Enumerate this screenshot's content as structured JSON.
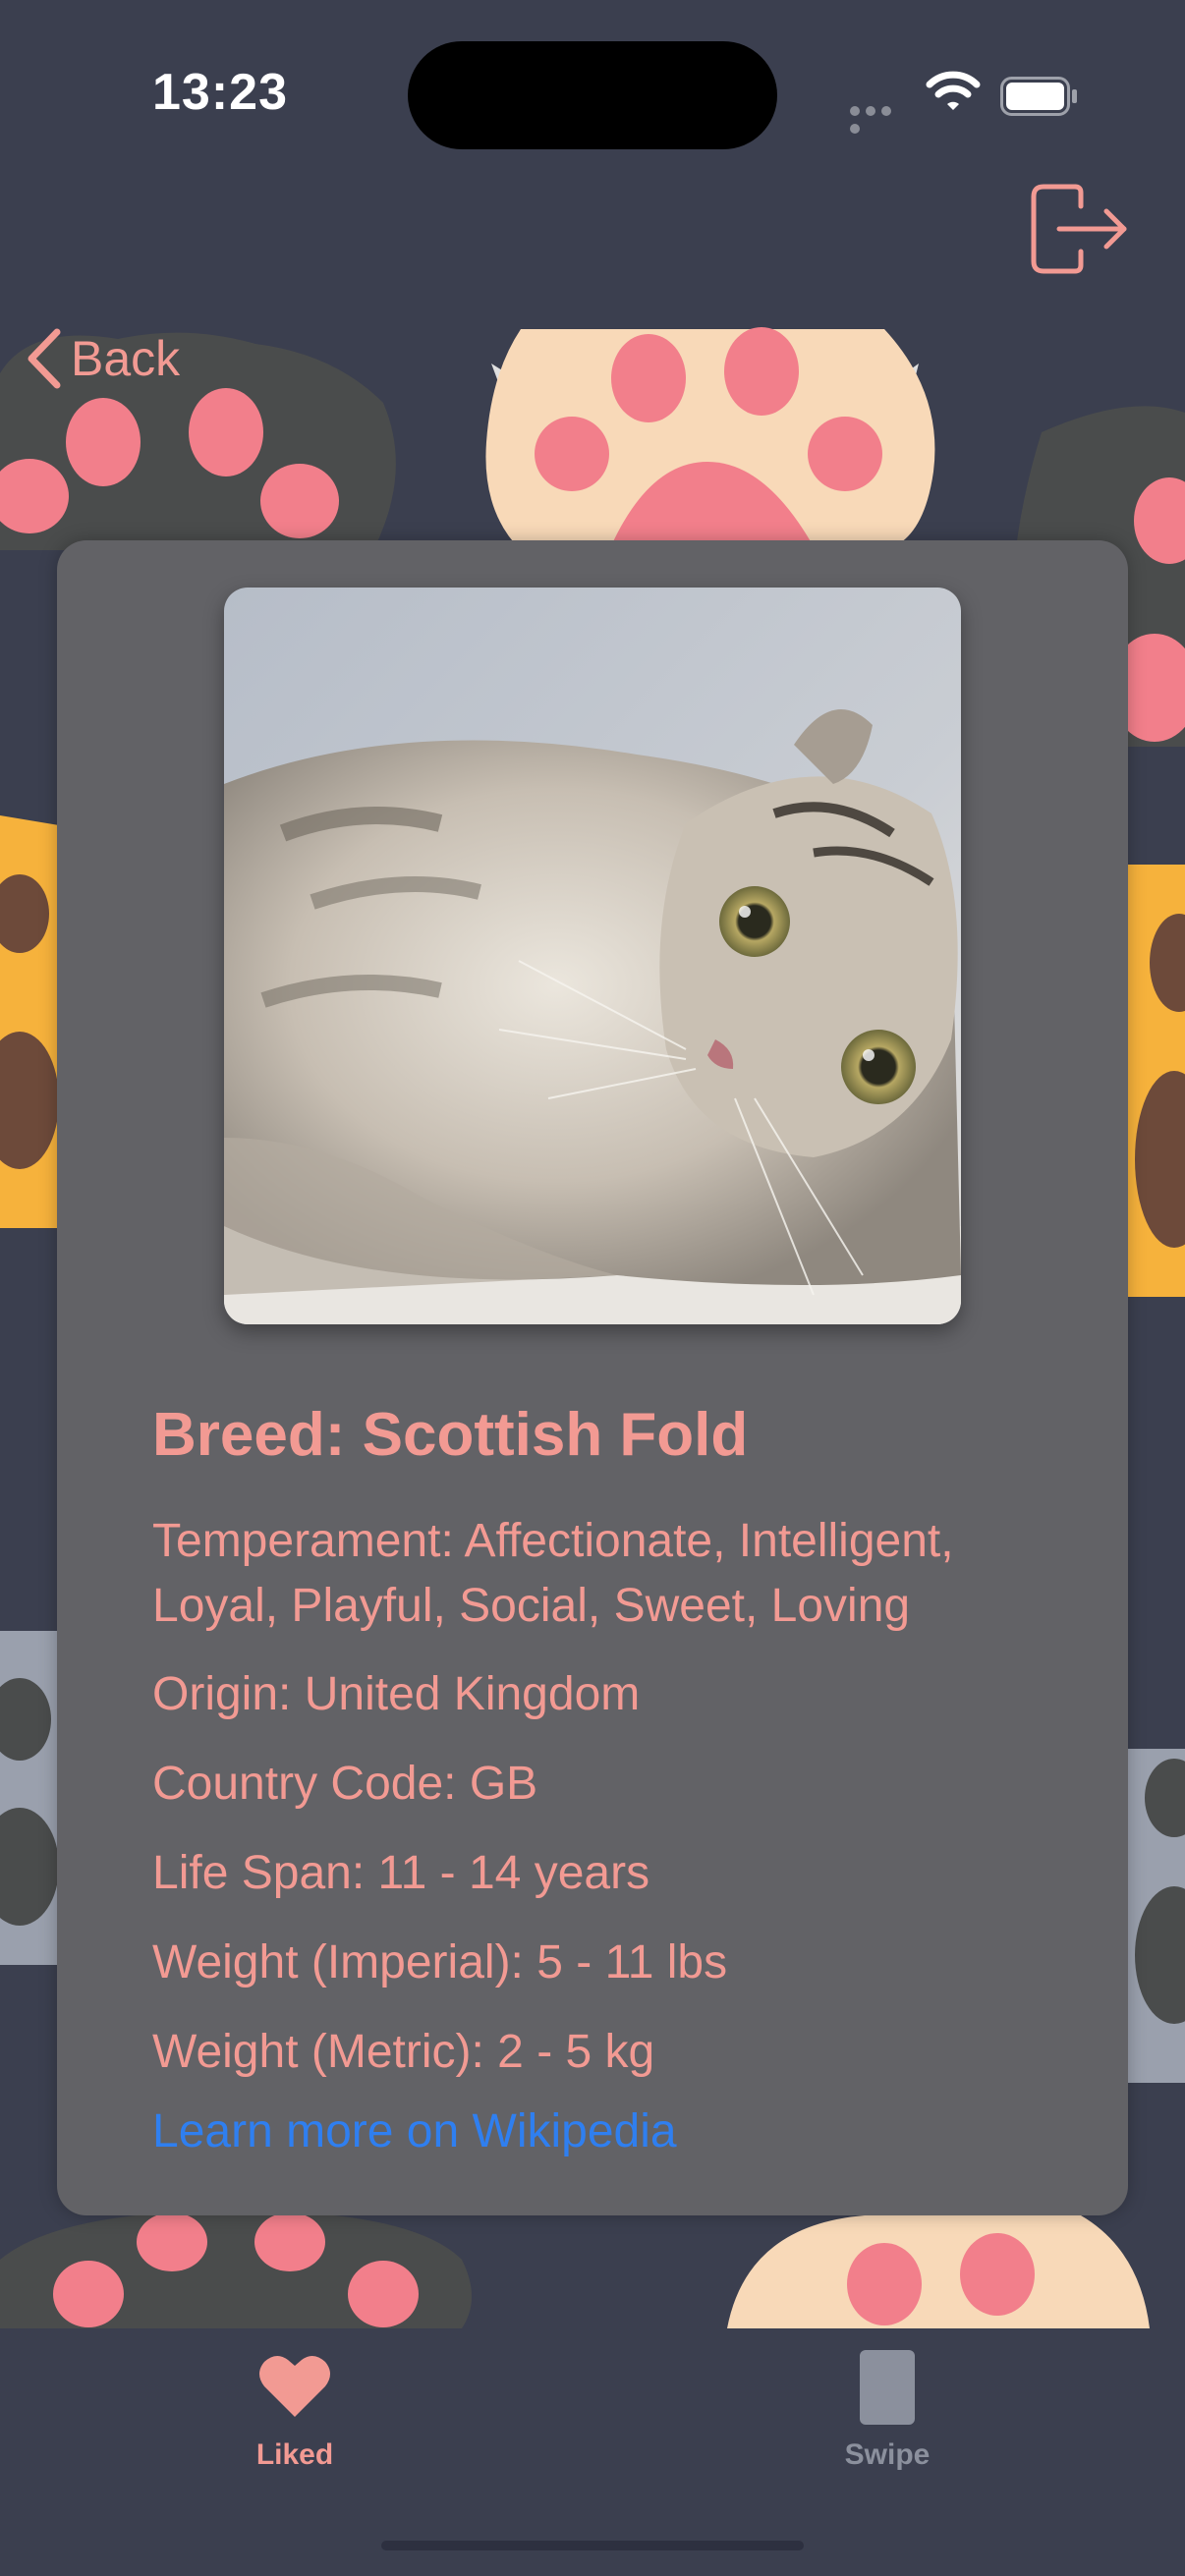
{
  "status_bar": {
    "time": "13:23"
  },
  "header": {
    "back_label": "Back",
    "logout_icon": "logout-icon"
  },
  "detail": {
    "breed": "Breed: Scottish Fold",
    "temperament_line1": "Temperament: Affectionate, Intelligent,",
    "temperament_line2": "Loyal, Playful, Social, Sweet, Loving",
    "origin": "Origin: United Kingdom",
    "country_code": "Country Code: GB",
    "life_span": "Life Span: 11 - 14 years",
    "weight_imperial": "Weight (Imperial): 5 - 11 lbs",
    "weight_metric": "Weight (Metric): 2 - 5 kg",
    "wiki_link": "Learn more on Wikipedia"
  },
  "tabs": [
    {
      "label": "Liked",
      "icon": "heart-icon",
      "active": true
    },
    {
      "label": "Swipe",
      "icon": "card-icon",
      "active": false
    }
  ],
  "colors": {
    "accent": "#f29a93",
    "link": "#2f7ff0",
    "background": "#3b3f4f",
    "card": "#626266",
    "inactive": "#8b909d"
  }
}
